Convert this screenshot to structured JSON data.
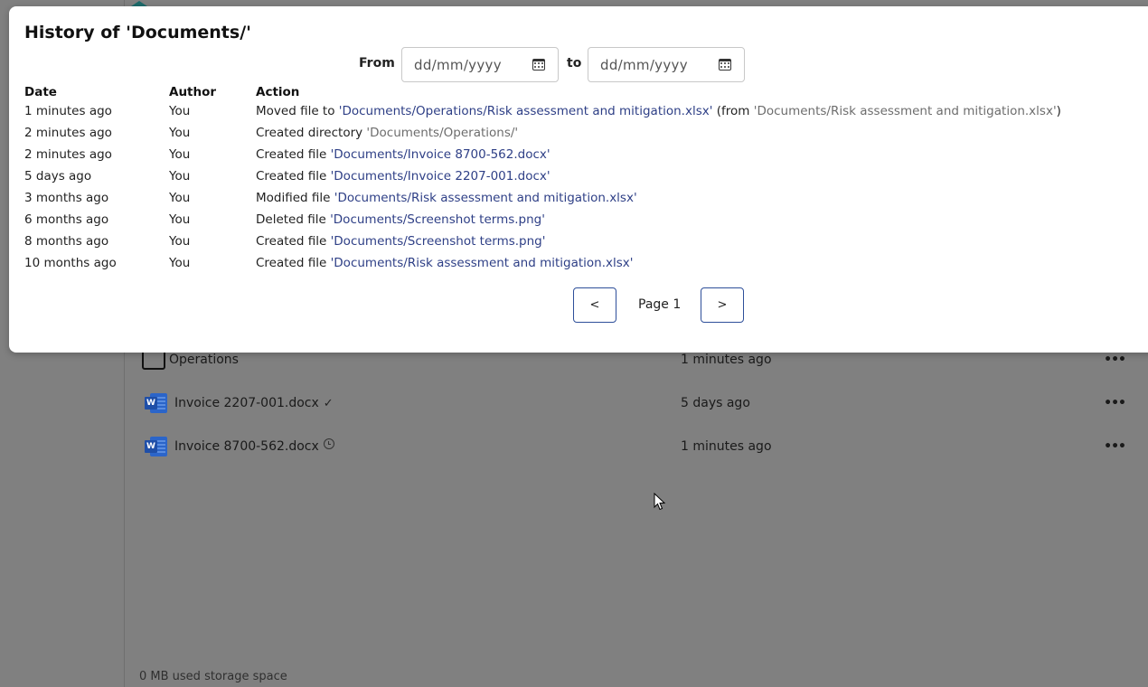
{
  "modal": {
    "title": "History of 'Documents/'",
    "filter": {
      "from_label": "From",
      "to_label": "to",
      "from_placeholder": "dd/mm/yyyy",
      "to_placeholder": "dd/mm/yyyy"
    },
    "columns": {
      "date": "Date",
      "author": "Author",
      "action": "Action"
    },
    "rows": [
      {
        "date": "1 minutes ago",
        "author": "You",
        "action": "Moved file to ",
        "target": "'Documents/Operations/Risk assessment and mitigation.xlsx'",
        "extra_pre": " (from ",
        "extra_target": "'Documents/Risk assessment and mitigation.xlsx'",
        "extra_post": ")"
      },
      {
        "date": "2 minutes ago",
        "author": "You",
        "action": "Created directory ",
        "target": "'Documents/Operations/'"
      },
      {
        "date": "2 minutes ago",
        "author": "You",
        "action": "Created file ",
        "target": "'Documents/Invoice 8700-562.docx'"
      },
      {
        "date": "5 days ago",
        "author": "You",
        "action": "Created file ",
        "target": "'Documents/Invoice 2207-001.docx'"
      },
      {
        "date": "3 months ago",
        "author": "You",
        "action": "Modified file ",
        "target": "'Documents/Risk assessment and mitigation.xlsx'"
      },
      {
        "date": "6 months ago",
        "author": "You",
        "action": "Deleted file ",
        "target": "'Documents/Screenshot terms.png'"
      },
      {
        "date": "8 months ago",
        "author": "You",
        "action": "Created file ",
        "target": "'Documents/Screenshot terms.png'"
      },
      {
        "date": "10 months ago",
        "author": "You",
        "action": "Created file ",
        "target": "'Documents/Risk assessment and mitigation.xlsx'"
      }
    ],
    "pager": {
      "prev": "<",
      "label": "Page 1",
      "next": ">"
    }
  },
  "files": [
    {
      "name": "Operations",
      "status": "",
      "date": "1 minutes ago",
      "more": "•••",
      "icon": "folder-icon"
    },
    {
      "name": "Invoice 2207-001.docx",
      "status": "✓",
      "date": "5 days ago",
      "more": "•••",
      "icon": "word-icon"
    },
    {
      "name": "Invoice 8700-562.docx",
      "status": "clock",
      "date": "1 minutes ago",
      "more": "•••",
      "icon": "word-icon"
    }
  ],
  "storage": "0 MB used storage space",
  "colors": {
    "overlay": "#808080",
    "link": "#2e3f86",
    "muted_link": "#6d6d6d",
    "pager_border": "#2e4f9a"
  }
}
